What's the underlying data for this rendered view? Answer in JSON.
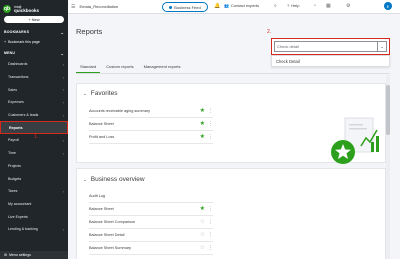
{
  "brand": {
    "logo_line1": "intuit",
    "logo_line2": "quickbooks",
    "logo_mark": "qb"
  },
  "sidebar": {
    "new_label": "New",
    "bookmarks_label": "BOOKMARKS",
    "bookmark_item": "Bookmark this page",
    "menu_label": "MENU",
    "items": [
      {
        "label": "Dashboards",
        "arrow": true
      },
      {
        "label": "Transactions",
        "arrow": true
      },
      {
        "label": "Sales",
        "arrow": true
      },
      {
        "label": "Expenses",
        "arrow": true
      },
      {
        "label": "Customers & leads",
        "arrow": true
      },
      {
        "label": "Reports",
        "arrow": false
      },
      {
        "label": "Payroll",
        "arrow": true
      },
      {
        "label": "Time",
        "arrow": true
      },
      {
        "label": "Projects",
        "arrow": false
      },
      {
        "label": "Budgets",
        "arrow": false
      },
      {
        "label": "Taxes",
        "arrow": true
      },
      {
        "label": "My accountant",
        "arrow": false
      },
      {
        "label": "Live Experts",
        "arrow": false
      },
      {
        "label": "Lending & banking",
        "arrow": true
      }
    ],
    "menu_settings": "Menu settings",
    "annotation": "1."
  },
  "topbar": {
    "company": "Emata_Reconciliation",
    "feed_label": "Business Feed",
    "contact_label": "Contact experts",
    "help_label": "Help",
    "avatar": "E"
  },
  "main": {
    "title": "Reports",
    "annotation": "2.",
    "search_placeholder": "Check detail",
    "dropdown_item": "Check Detail",
    "tabs": [
      {
        "label": "Standard",
        "active": true
      },
      {
        "label": "Custom reports",
        "active": false
      },
      {
        "label": "Management reports",
        "active": false
      }
    ],
    "favorites": {
      "title": "Favorites",
      "rows": [
        {
          "label": "Accounts receivable aging summary",
          "starred": true
        },
        {
          "label": "Balance Sheet",
          "starred": true
        },
        {
          "label": "Profit and Loss",
          "starred": true
        }
      ]
    },
    "overview": {
      "title": "Business overview",
      "rows": [
        {
          "label": "Audit Log",
          "starred": null
        },
        {
          "label": "Balance Sheet",
          "starred": true
        },
        {
          "label": "Balance Sheet Comparison",
          "starred": false
        },
        {
          "label": "Balance Sheet Detail",
          "starred": false
        },
        {
          "label": "Balance Sheet Summary",
          "starred": false
        }
      ]
    }
  },
  "colors": {
    "brand_green": "#2ca01c",
    "sidebar_bg": "#21262a",
    "annotation_red": "#d52b1e",
    "link_blue": "#0077c5"
  }
}
